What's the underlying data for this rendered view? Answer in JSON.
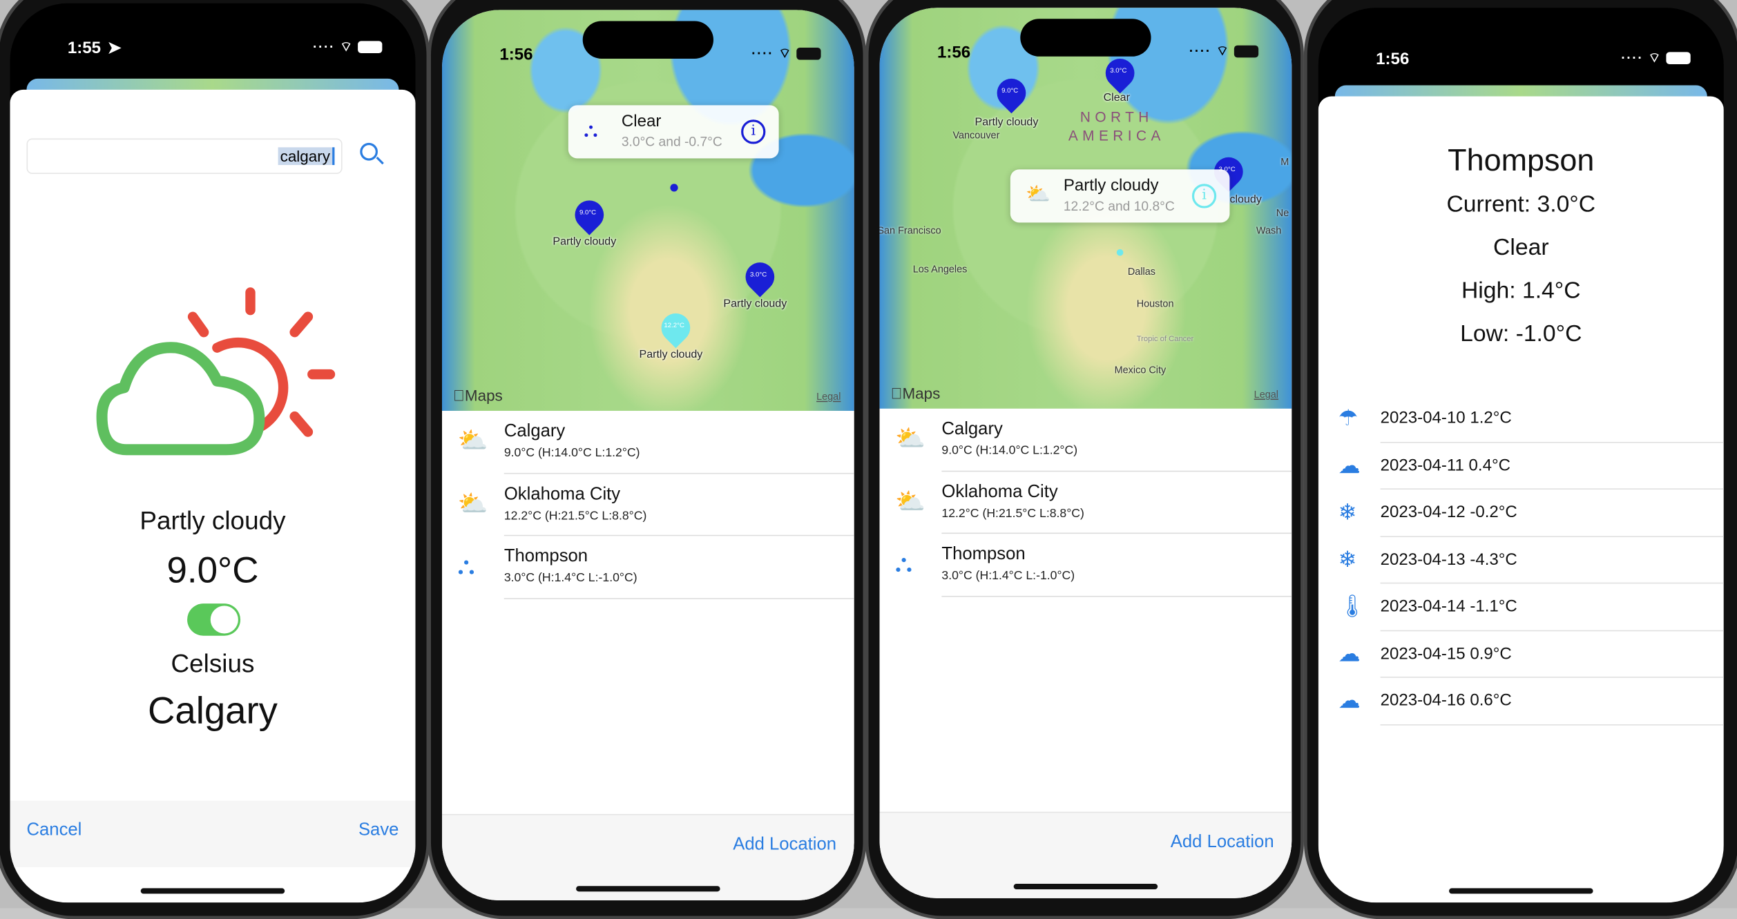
{
  "screen1": {
    "time": "1:55",
    "search_value": "calgary",
    "condition": "Partly cloudy",
    "temperature": "9.0°C",
    "unit_toggle_on": true,
    "unit_label": "Celsius",
    "city": "Calgary",
    "cancel": "Cancel",
    "save": "Save"
  },
  "screen2": {
    "time": "1:56",
    "callout": {
      "title": "Clear",
      "subtitle": "3.0°C and -0.7°C"
    },
    "pins": [
      {
        "temp": "9.0°C",
        "label": "Partly cloudy"
      },
      {
        "temp": "3.0°C",
        "label": "Partly cloudy"
      },
      {
        "temp": "12.2°C",
        "label": "Partly cloudy"
      }
    ],
    "maps_brand": "Maps",
    "legal": "Legal",
    "add_location": "Add Location"
  },
  "screen3": {
    "time": "1:56",
    "callout": {
      "title": "Partly cloudy",
      "subtitle": "12.2°C and 10.8°C"
    },
    "pins": [
      {
        "temp": "3.0°C",
        "label": "Clear"
      },
      {
        "temp": "9.0°C",
        "label": "Partly cloudy"
      },
      {
        "temp": "3.0°C",
        "label": "cloudy"
      }
    ],
    "region": "NORTH AMERICA",
    "cities": [
      "Vancouver",
      "San Francisco",
      "Los Angeles",
      "Dallas",
      "Houston",
      "Mexico City",
      "Wash",
      "Ne",
      "M"
    ],
    "tropic": "Tropic of Cancer",
    "maps_brand": "Maps",
    "legal": "Legal",
    "add_location": "Add Location"
  },
  "locations": [
    {
      "name": "Calgary",
      "detail": "9.0°C (H:14.0°C L:1.2°C)",
      "icon": "cloud-sun-icon"
    },
    {
      "name": "Oklahoma City",
      "detail": "12.2°C (H:21.5°C L:8.8°C)",
      "icon": "cloud-sun-icon"
    },
    {
      "name": "Thompson",
      "detail": "3.0°C (H:1.4°C L:-1.0°C)",
      "icon": "sunrise-icon"
    }
  ],
  "screen4": {
    "time": "1:56",
    "city": "Thompson",
    "current": "Current: 3.0°C",
    "condition": "Clear",
    "high": "High: 1.4°C",
    "low": "Low: -1.0°C",
    "forecast": [
      {
        "text": "2023-04-10 1.2°C",
        "icon": "cloud-rain-icon"
      },
      {
        "text": "2023-04-11 0.4°C",
        "icon": "cloud-fog-icon"
      },
      {
        "text": "2023-04-12 -0.2°C",
        "icon": "snowflake-icon"
      },
      {
        "text": "2023-04-13 -4.3°C",
        "icon": "snowflake-icon"
      },
      {
        "text": "2023-04-14 -1.1°C",
        "icon": "thermometer-snow-icon"
      },
      {
        "text": "2023-04-15 0.9°C",
        "icon": "cloud-icon"
      },
      {
        "text": "2023-04-16 0.6°C",
        "icon": "cloud-fog-icon"
      }
    ]
  },
  "colors": {
    "accent": "#2a7de1",
    "pin": "#1a1fd6",
    "pin_light": "#6ee8ee",
    "toggle": "#5ac85a",
    "sun": "#e84c3d",
    "cloud": "#5fbf5f"
  }
}
